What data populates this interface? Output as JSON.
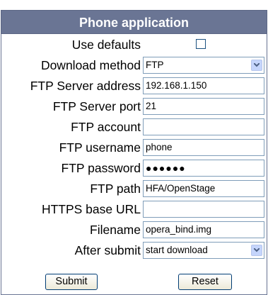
{
  "app": {
    "title": "Phone application"
  },
  "form": {
    "use_defaults": {
      "label": "Use defaults",
      "checked": false
    },
    "download_method": {
      "label": "Download method",
      "value": "FTP"
    },
    "ftp_server_address": {
      "label": "FTP Server address",
      "value": "192.168.1.150"
    },
    "ftp_server_port": {
      "label": "FTP Server port",
      "value": "21"
    },
    "ftp_account": {
      "label": "FTP account",
      "value": ""
    },
    "ftp_username": {
      "label": "FTP username",
      "value": "phone"
    },
    "ftp_password": {
      "label": "FTP password",
      "value": "●●●●●●"
    },
    "ftp_path": {
      "label": "FTP path",
      "value": "HFA/OpenStage"
    },
    "https_base_url": {
      "label": "HTTPS base URL",
      "value": ""
    },
    "filename": {
      "label": "Filename",
      "value": "opera_bind.img"
    },
    "after_submit": {
      "label": "After submit",
      "value": "start download"
    }
  },
  "buttons": {
    "submit": "Submit",
    "reset": "Reset"
  },
  "colors": {
    "title_bar": "#6a7594",
    "field_border": "#7f9db9",
    "select_arrow_bg": "#c5d5fc"
  },
  "icons": {
    "select_arrow": "chevron-down-icon"
  }
}
